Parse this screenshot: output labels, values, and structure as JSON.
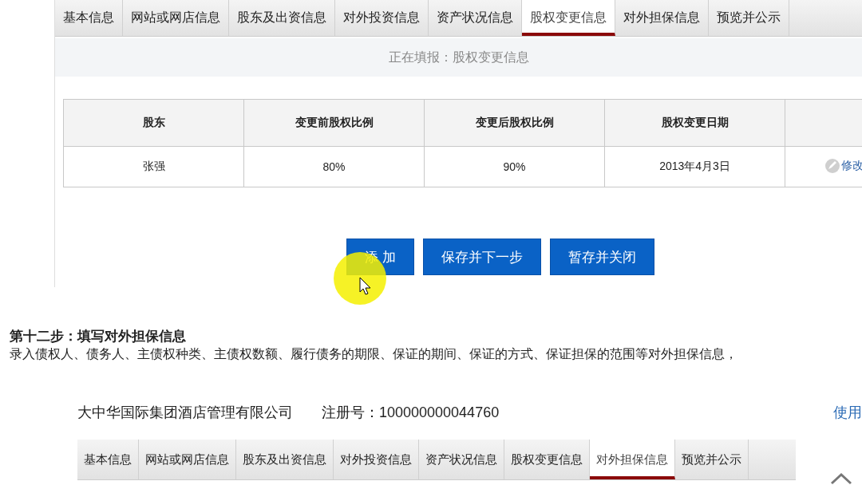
{
  "top_panel": {
    "tabs": [
      {
        "label": "基本信息",
        "selected": false
      },
      {
        "label": "网站或网店信息",
        "selected": false
      },
      {
        "label": "股东及出资信息",
        "selected": false
      },
      {
        "label": "对外投资信息",
        "selected": false
      },
      {
        "label": "资产状况信息",
        "selected": false
      },
      {
        "label": "股权变更信息",
        "selected": true
      },
      {
        "label": "对外担保信息",
        "selected": false
      },
      {
        "label": "预览并公示",
        "selected": false
      }
    ],
    "status": "正在填报：股权变更信息",
    "table": {
      "columns": [
        "股东",
        "变更前股权比例",
        "变更后股权比例",
        "股权变更日期"
      ],
      "rows": [
        {
          "cells": [
            "张强",
            "80%",
            "90%",
            "2013年4月3日"
          ],
          "action": "修改"
        }
      ]
    },
    "buttons": [
      "添 加",
      "保存并下一步",
      "暂存并关闭"
    ]
  },
  "step": {
    "title": "第十二步：填写对外担保信息",
    "description": "录入债权人、债务人、主债权种类、主债权数额、履行债务的期限、保证的期间、保证的方式、保证担保的范围等对外担保信息，"
  },
  "bottom_panel": {
    "company": "大中华国际集团酒店管理有限公司",
    "registration": "注册号：100000000044760",
    "help_link": "使用",
    "tabs": [
      {
        "label": "基本信息",
        "selected": false
      },
      {
        "label": "网站或网店信息",
        "selected": false
      },
      {
        "label": "股东及出资信息",
        "selected": false
      },
      {
        "label": "对外投资信息",
        "selected": false
      },
      {
        "label": "资产状况信息",
        "selected": false
      },
      {
        "label": "股权变更信息",
        "selected": false
      },
      {
        "label": "对外担保信息",
        "selected": true
      },
      {
        "label": "预览并公示",
        "selected": false
      }
    ]
  }
}
